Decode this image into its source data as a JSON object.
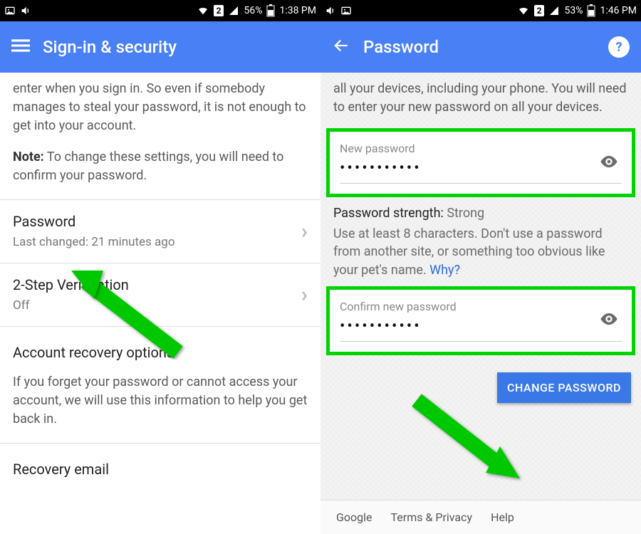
{
  "left": {
    "status": {
      "battery": "56%",
      "time": "1:38 PM",
      "sim": "2"
    },
    "appbar": {
      "title": "Sign-in & security"
    },
    "intro": "enter when you sign in. So even if somebody manages to steal your password, it is not enough to get into your account.",
    "note_label": "Note:",
    "note_text": " To change these settings, you will need to confirm your password.",
    "rows": {
      "password": {
        "title": "Password",
        "sub": "Last changed: 21 minutes ago"
      },
      "twostep": {
        "title": "2-Step Verification",
        "sub": "Off"
      }
    },
    "recovery": {
      "title": "Account recovery options",
      "desc": "If you forget your password or cannot access your account, we will use this information to help you get back in."
    },
    "partial_row": "Recovery email"
  },
  "right": {
    "status": {
      "battery": "53%",
      "time": "1:46 PM",
      "sim": "2"
    },
    "appbar": {
      "title": "Password",
      "help": "?"
    },
    "intro": "all your devices, including your phone. You will need to enter your new password on all your devices.",
    "fields": {
      "new": {
        "label": "New password",
        "value": "•••••••••••"
      },
      "confirm": {
        "label": "Confirm new password",
        "value": "•••••••••••"
      }
    },
    "strength": {
      "label": "Password strength:",
      "value": "Strong"
    },
    "hint": "Use at least 8 characters. Don't use a password from another site, or something too obvious like your pet's name. ",
    "why": "Why?",
    "button": "CHANGE PASSWORD",
    "footer": {
      "google": "Google",
      "terms": "Terms & Privacy",
      "help": "Help"
    }
  }
}
